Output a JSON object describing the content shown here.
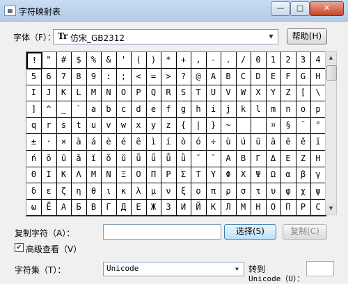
{
  "window": {
    "title": "字符映射表",
    "min_label": "—",
    "max_label": "□",
    "close_label": "✕"
  },
  "font": {
    "label": "字体（F）：",
    "value": "仿宋_GB2312",
    "font_icon": "Tr"
  },
  "buttons": {
    "help": "帮助(H)",
    "select": "选择(S)",
    "copy": "复制(C)"
  },
  "grid": {
    "rows": [
      [
        "!",
        "\"",
        "#",
        "$",
        "%",
        "&",
        "'",
        "(",
        ")",
        "*",
        "+",
        ",",
        "-",
        ".",
        "/",
        "0",
        "1",
        "2",
        "3",
        "4"
      ],
      [
        "5",
        "6",
        "7",
        "8",
        "9",
        ":",
        ";",
        "<",
        "=",
        ">",
        "?",
        "@",
        "A",
        "B",
        "C",
        "D",
        "E",
        "F",
        "G",
        "H"
      ],
      [
        "I",
        "J",
        "K",
        "L",
        "M",
        "N",
        "O",
        "P",
        "Q",
        "R",
        "S",
        "T",
        "U",
        "V",
        "W",
        "X",
        "Y",
        "Z",
        "[",
        "\\"
      ],
      [
        "]",
        "^",
        "_",
        "`",
        "a",
        "b",
        "c",
        "d",
        "e",
        "f",
        "g",
        "h",
        "i",
        "j",
        "k",
        "l",
        "m",
        "n",
        "o",
        "p"
      ],
      [
        "q",
        "r",
        "s",
        "t",
        "u",
        "v",
        "w",
        "x",
        "y",
        "z",
        "{",
        "|",
        "}",
        "~",
        "",
        "",
        "¤",
        "§",
        "¨",
        "°"
      ],
      [
        "±",
        "·",
        "×",
        "à",
        "á",
        "è",
        "é",
        "ê",
        "ì",
        "í",
        "ò",
        "ó",
        "÷",
        "ù",
        "ú",
        "ü",
        "ā",
        "ē",
        "ě",
        "ī"
      ],
      [
        "ń",
        "ō",
        "ū",
        "ǎ",
        "ǐ",
        "ǒ",
        "ǔ",
        "ǖ",
        "ǘ",
        "ǚ",
        "ǜ",
        "ˇ",
        "ˉ",
        "Α",
        "Β",
        "Γ",
        "Δ",
        "Ε",
        "Ζ",
        "Η"
      ],
      [
        "Θ",
        "Ι",
        "Κ",
        "Λ",
        "Μ",
        "Ν",
        "Ξ",
        "Ο",
        "Π",
        "Ρ",
        "Σ",
        "Τ",
        "Υ",
        "Φ",
        "Χ",
        "Ψ",
        "Ω",
        "α",
        "β",
        "γ"
      ],
      [
        "δ",
        "ε",
        "ζ",
        "η",
        "θ",
        "ι",
        "κ",
        "λ",
        "μ",
        "ν",
        "ξ",
        "ο",
        "π",
        "ρ",
        "σ",
        "τ",
        "υ",
        "φ",
        "χ",
        "ψ"
      ],
      [
        "ω",
        "Ё",
        "А",
        "Б",
        "В",
        "Г",
        "Д",
        "Е",
        "Ж",
        "З",
        "И",
        "Й",
        "К",
        "Л",
        "М",
        "Н",
        "О",
        "П",
        "Р",
        "С"
      ]
    ]
  },
  "copy_field": {
    "label": "复制字符（A）：",
    "value": ""
  },
  "advanced": {
    "label": "高级查看（V）",
    "checked": true
  },
  "charset": {
    "label": "字符集（T）：",
    "value": "Unicode"
  },
  "goto": {
    "label": "转到",
    "sublabel": "Unicode（U）："
  },
  "colors": {
    "title_bar": "#b9cfe9",
    "select_button": "#bfe0f7"
  }
}
